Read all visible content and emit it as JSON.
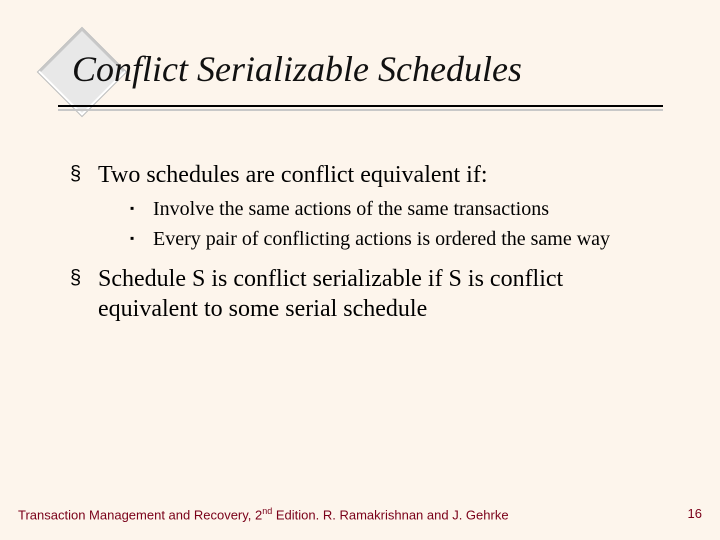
{
  "title": "Conflict Serializable Schedules",
  "bullets": [
    {
      "text": "Two schedules are conflict equivalent if:",
      "sub": [
        "Involve the same actions of the same transactions",
        "Every pair of conflicting actions is ordered the same way"
      ]
    },
    {
      "text": "Schedule S is conflict serializable if S is conflict equivalent to some serial schedule",
      "sub": []
    }
  ],
  "footer": {
    "left_pre": "Transaction Management and Recovery, 2",
    "left_sup": "nd",
    "left_post": " Edition. R. Ramakrishnan and J. Gehrke",
    "page": "16"
  },
  "glyphs": {
    "l1_bullet": "§",
    "l2_bullet": "▪"
  }
}
